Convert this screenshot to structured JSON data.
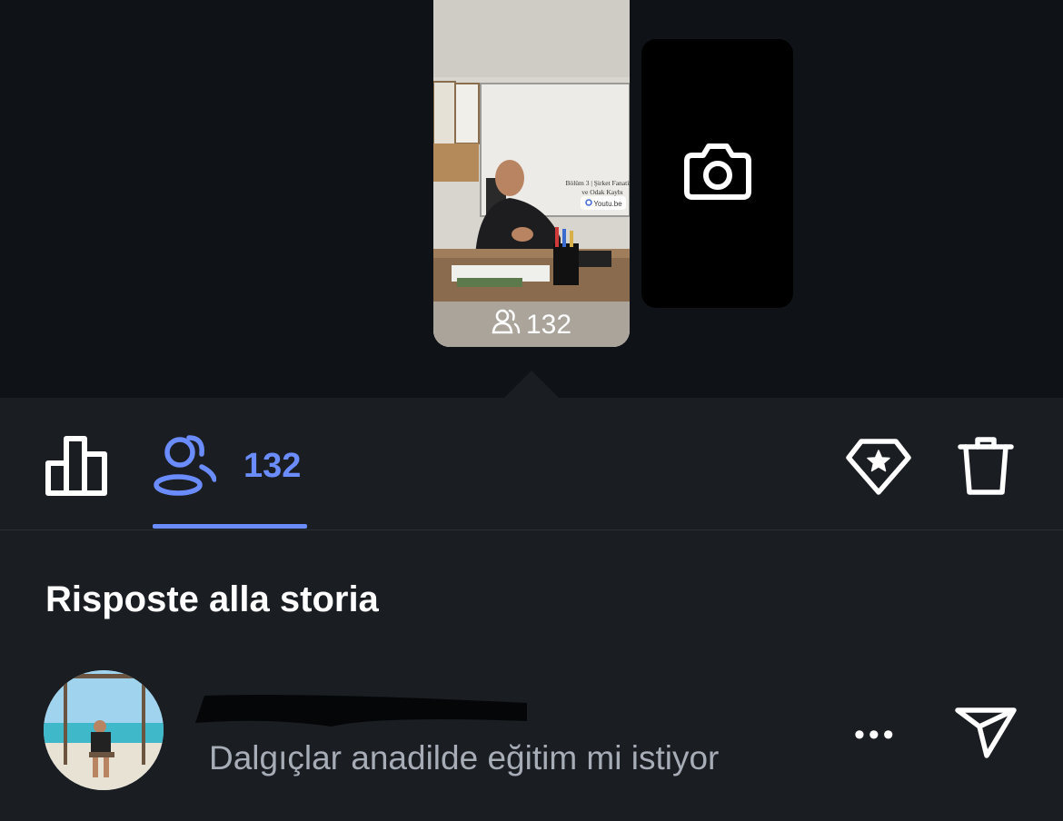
{
  "story": {
    "viewers_count": "132",
    "overlay_text": {
      "line1": "Bölüm 3 | Şirket Fanatizmi",
      "line2": "ve Odak Kaybı",
      "link_chip": "Youtu.be"
    }
  },
  "toolbar": {
    "viewers_count": "132"
  },
  "section": {
    "title": "Risposte alla storia"
  },
  "reply": {
    "message": "Dalgıçlar anadilde eğitim mi istiyor",
    "more_label": "•••"
  },
  "colors": {
    "accent": "#6b8cff",
    "background": "#0f1217",
    "sheet": "#1a1d22"
  }
}
